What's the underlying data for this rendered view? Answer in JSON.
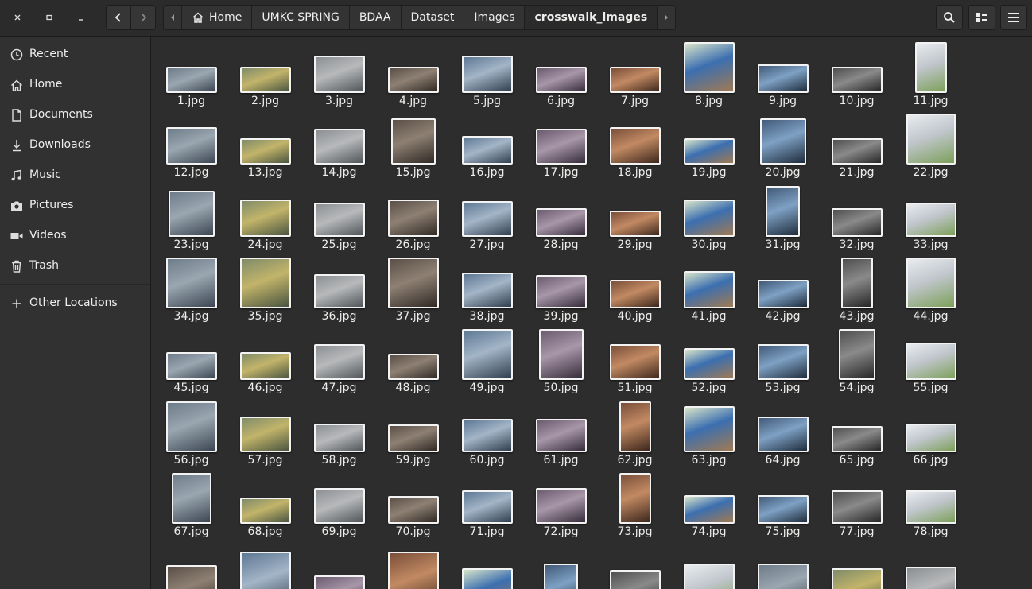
{
  "window": {
    "close_icon": "close-icon",
    "maximize_icon": "maximize-icon",
    "minimize_icon": "minimize-icon"
  },
  "nav": {
    "back_icon": "chevron-left-icon",
    "forward_icon": "chevron-right-icon"
  },
  "breadcrumb": {
    "left_arrow_icon": "chevron-left-icon",
    "home_icon": "home-icon",
    "items": [
      "Home",
      "UMKC SPRING",
      "BDAA",
      "Dataset",
      "Images",
      "crosswalk_images"
    ],
    "right_arrow_icon": "chevron-right-icon"
  },
  "toolbar": {
    "search_icon": "search-icon",
    "view_icon": "view-options-icon",
    "menu_icon": "hamburger-menu-icon"
  },
  "sidebar": {
    "items": [
      {
        "label": "Recent",
        "icon": "clock-icon"
      },
      {
        "label": "Home",
        "icon": "home-icon"
      },
      {
        "label": "Documents",
        "icon": "document-icon"
      },
      {
        "label": "Downloads",
        "icon": "download-icon"
      },
      {
        "label": "Music",
        "icon": "music-icon"
      },
      {
        "label": "Pictures",
        "icon": "camera-icon"
      },
      {
        "label": "Videos",
        "icon": "video-icon"
      },
      {
        "label": "Trash",
        "icon": "trash-icon"
      }
    ],
    "other": {
      "label": "Other Locations",
      "icon": "plus-icon"
    }
  },
  "files": [
    "1.jpg",
    "2.jpg",
    "3.jpg",
    "4.jpg",
    "5.jpg",
    "6.jpg",
    "7.jpg",
    "8.jpg",
    "9.jpg",
    "10.jpg",
    "11.jpg",
    "12.jpg",
    "13.jpg",
    "14.jpg",
    "15.jpg",
    "16.jpg",
    "17.jpg",
    "18.jpg",
    "19.jpg",
    "20.jpg",
    "21.jpg",
    "22.jpg",
    "23.jpg",
    "24.jpg",
    "25.jpg",
    "26.jpg",
    "27.jpg",
    "28.jpg",
    "29.jpg",
    "30.jpg",
    "31.jpg",
    "32.jpg",
    "33.jpg",
    "34.jpg",
    "35.jpg",
    "36.jpg",
    "37.jpg",
    "38.jpg",
    "39.jpg",
    "40.jpg",
    "41.jpg",
    "42.jpg",
    "43.jpg",
    "44.jpg",
    "45.jpg",
    "46.jpg",
    "47.jpg",
    "48.jpg",
    "49.jpg",
    "50.jpg",
    "51.jpg",
    "52.jpg",
    "53.jpg",
    "54.jpg",
    "55.jpg",
    "56.jpg",
    "57.jpg",
    "58.jpg",
    "59.jpg",
    "60.jpg",
    "61.jpg",
    "62.jpg",
    "63.jpg",
    "64.jpg",
    "65.jpg",
    "66.jpg",
    "67.jpg",
    "68.jpg",
    "69.jpg",
    "70.jpg",
    "71.jpg",
    "72.jpg",
    "73.jpg",
    "74.jpg",
    "75.jpg",
    "77.jpg",
    "78.jpg"
  ],
  "partial_row_count": 11
}
